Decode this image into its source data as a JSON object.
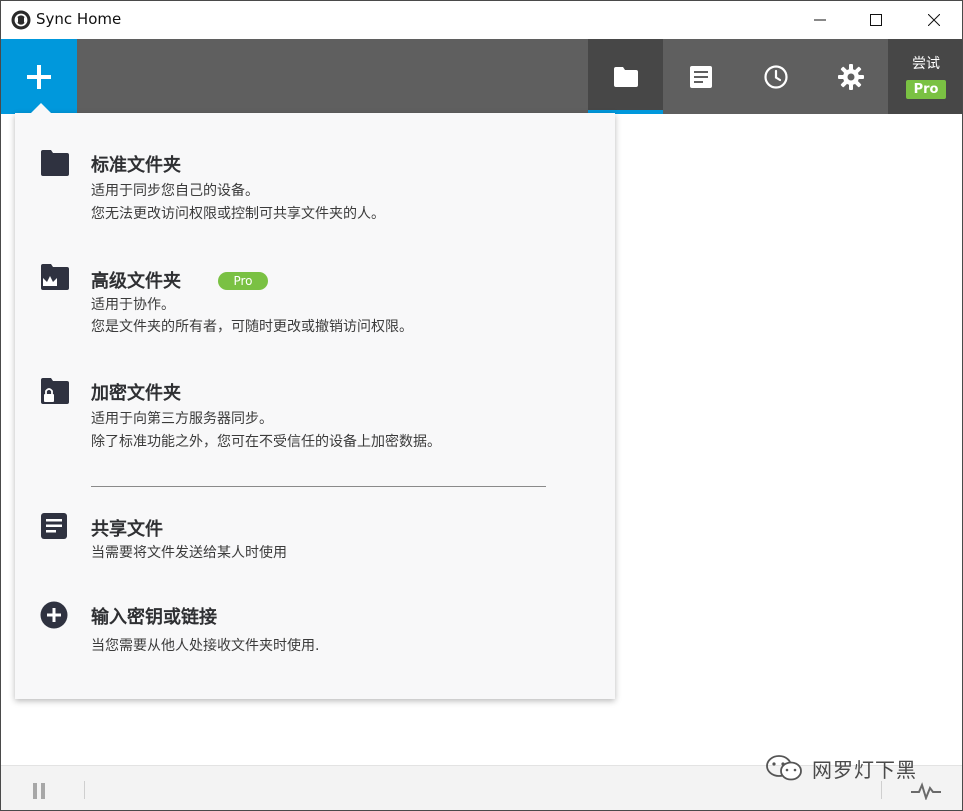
{
  "window": {
    "title": "Sync Home"
  },
  "toolbar": {
    "add_button_icon": "plus-icon",
    "tabs": [
      {
        "name": "folders",
        "icon": "folder-icon",
        "active": true
      },
      {
        "name": "files",
        "icon": "document-icon",
        "active": false
      },
      {
        "name": "history",
        "icon": "clock-icon",
        "active": false
      },
      {
        "name": "settings",
        "icon": "gear-icon",
        "active": false
      }
    ],
    "trial_label": "尝试",
    "pro_badge": "Pro"
  },
  "menu": {
    "items": [
      {
        "icon": "folder-icon",
        "title": "标准文件夹",
        "desc1": "适用于同步您自己的设备。",
        "desc2": "您无法更改访问权限或控制可共享文件夹的人。"
      },
      {
        "icon": "crown-folder-icon",
        "title": "高级文件夹",
        "badge": "Pro",
        "desc1": "适用于协作。",
        "desc2": "您是文件夹的所有者，可随时更改或撤销访问权限。"
      },
      {
        "icon": "lock-folder-icon",
        "title": "加密文件夹",
        "desc1": "适用于向第三方服务器同步。",
        "desc2": "除了标准功能之外，您可在不受信任的设备上加密数据。"
      },
      {
        "icon": "document-icon",
        "title": "共享文件",
        "desc1": "当需要将文件发送给某人时使用"
      },
      {
        "icon": "plus-circle-icon",
        "title": "输入密钥或链接",
        "desc1": "当您需要从他人处接收文件夹时使用."
      }
    ]
  },
  "watermark": {
    "text": "网罗灯下黑"
  },
  "colors": {
    "accent": "#0098dc",
    "toolbar": "#5f5f5f",
    "active_tab": "#474747",
    "pro": "#7ac143",
    "icon_dark": "#2f3240"
  }
}
